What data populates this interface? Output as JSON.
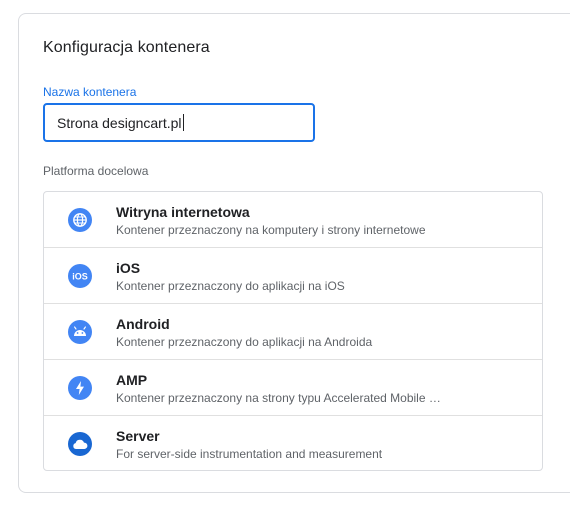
{
  "card": {
    "title": "Konfiguracja kontenera"
  },
  "container_name": {
    "label": "Nazwa kontenera",
    "value": "Strona designcart.pl"
  },
  "platform": {
    "label": "Platforma docelowa",
    "options": [
      {
        "icon": "globe-icon",
        "name": "Witryna internetowa",
        "description": "Kontener przeznaczony na komputery i strony internetowe"
      },
      {
        "icon": "ios-icon",
        "name": "iOS",
        "description": "Kontener przeznaczony do aplikacji na iOS"
      },
      {
        "icon": "android-icon",
        "name": "Android",
        "description": "Kontener przeznaczony do aplikacji na Androida"
      },
      {
        "icon": "amp-icon",
        "name": "AMP",
        "description": "Kontener przeznaczony na strony typu Accelerated Mobile Pages"
      },
      {
        "icon": "cloud-icon",
        "name": "Server",
        "description": "For server-side instrumentation and measurement"
      }
    ]
  },
  "colors": {
    "accent": "#1a73e8",
    "icon_blue": "#4285f4",
    "icon_dark_blue": "#1967d2",
    "border": "#dadce0"
  }
}
